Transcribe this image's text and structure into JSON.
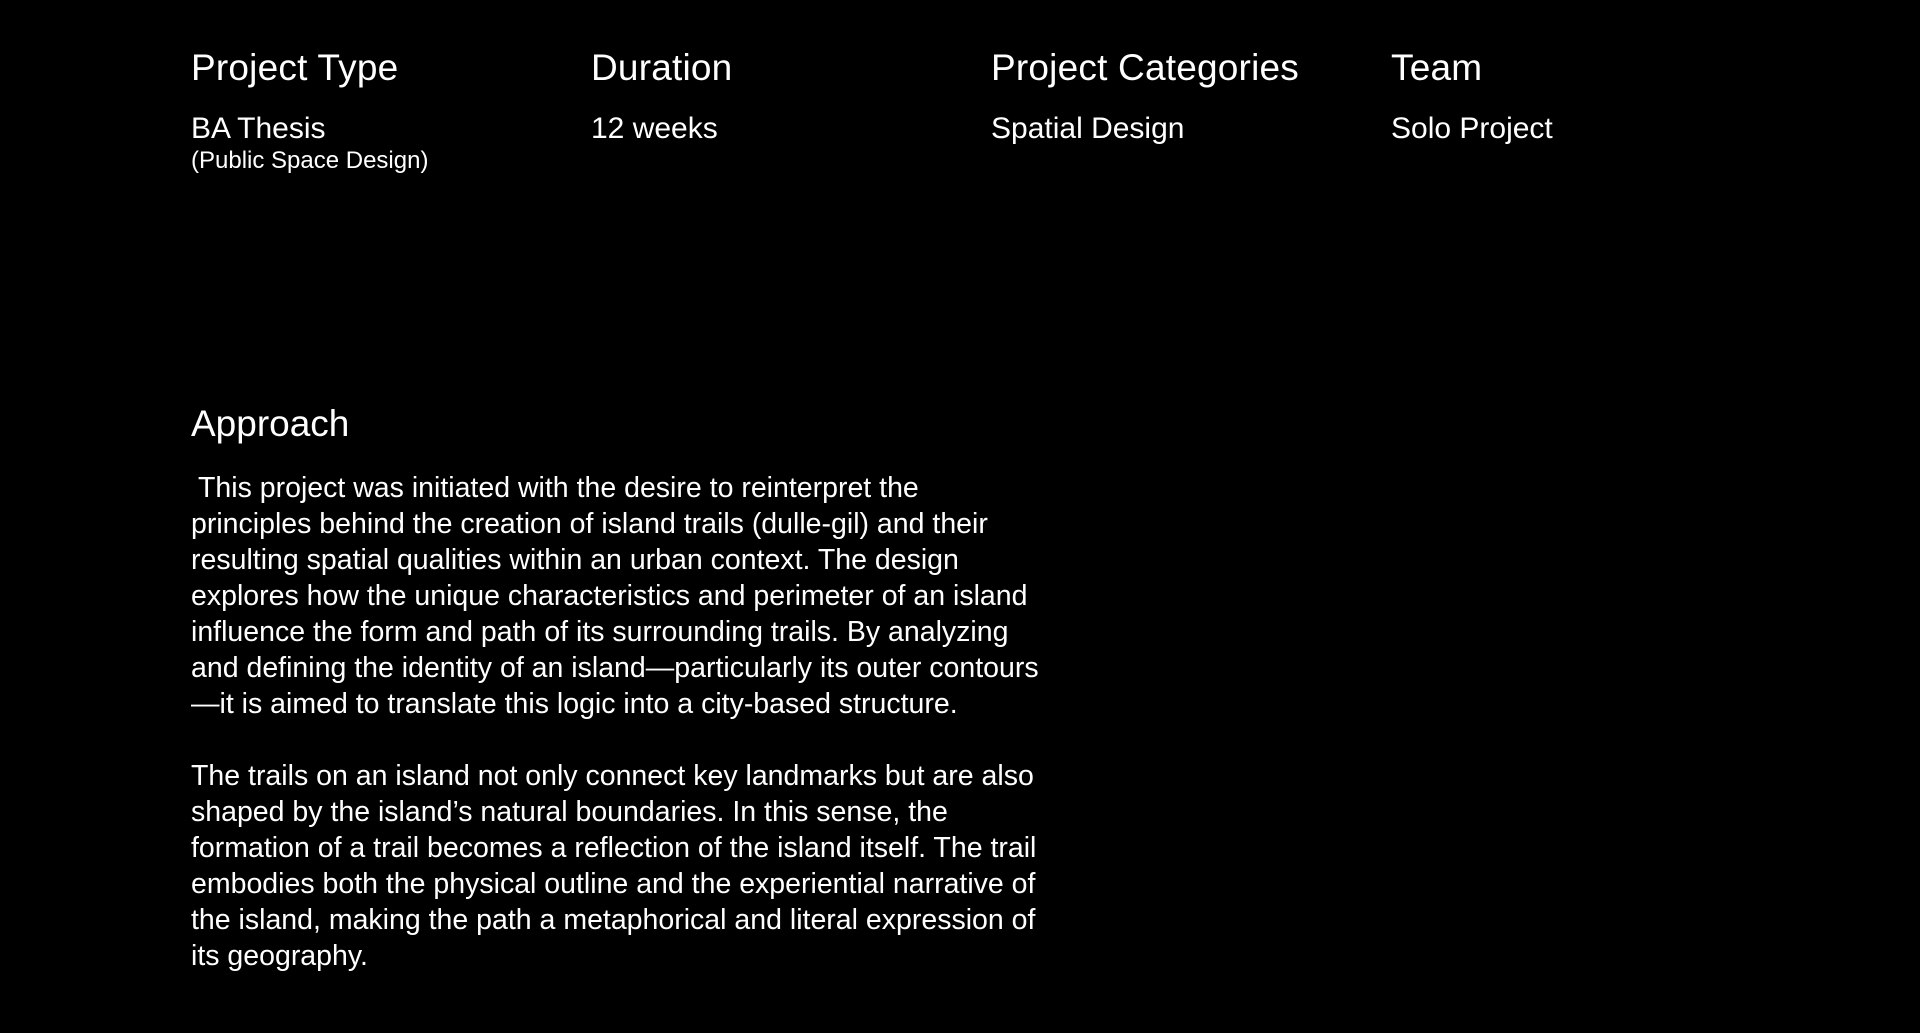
{
  "meta": [
    {
      "heading": "Project Type",
      "value": "BA Thesis",
      "subvalue": "(Public Space Design)"
    },
    {
      "heading": "Duration",
      "value": "12 weeks",
      "subvalue": ""
    },
    {
      "heading": "Project Categories",
      "value": "Spatial Design",
      "subvalue": ""
    },
    {
      "heading": "Team",
      "value": "Solo Project",
      "subvalue": ""
    }
  ],
  "approach": {
    "heading": "Approach",
    "paragraphs": [
      "This project was initiated with the desire to reinterpret the principles behind the creation of island trails (dulle-gil) and their resulting spatial qualities within an urban context. The design explores how the unique characteristics and perimeter of an island influence the form and path of its surrounding trails. By analyzing and defining the identity of an island—particularly its outer contours—it is aimed to translate this logic into a city-based structure.",
      "The trails on an island not only connect key landmarks but are also shaped by the island’s natural boundaries. In this sense, the formation of a trail becomes a reflection of the island itself. The trail embodies both the physical outline and the experiential narrative of the island, making the path a metaphorical and literal expression of its geography."
    ]
  },
  "colors": {
    "background": "#000000",
    "text": "#ffffff"
  }
}
